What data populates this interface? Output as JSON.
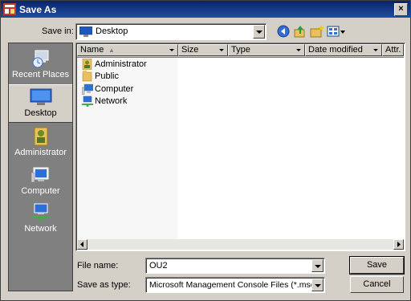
{
  "window": {
    "title": "Save As",
    "close_glyph": "×"
  },
  "toolbar": {
    "save_in_label": "Save in:",
    "save_in_value": "Desktop",
    "icons": [
      "back-icon",
      "up-folder-icon",
      "new-folder-icon",
      "view-menu-icon"
    ]
  },
  "places": [
    {
      "label": "Recent Places",
      "icon": "recent-places-icon"
    },
    {
      "label": "Desktop",
      "icon": "desktop-icon",
      "selected": true
    },
    {
      "label": "Administrator",
      "icon": "user-folder-icon"
    },
    {
      "label": "Computer",
      "icon": "computer-icon"
    },
    {
      "label": "Network",
      "icon": "network-icon"
    }
  ],
  "columns": [
    "Name",
    "Size",
    "Type",
    "Date modified",
    "Attr."
  ],
  "files": [
    {
      "name": "Administrator",
      "icon": "user-folder-icon"
    },
    {
      "name": "Public",
      "icon": "folder-icon"
    },
    {
      "name": "Computer",
      "icon": "computer-icon"
    },
    {
      "name": "Network",
      "icon": "network-icon"
    }
  ],
  "form": {
    "file_name_label": "File name:",
    "file_name_value": "OU2",
    "save_type_label": "Save as type:",
    "save_type_value": "Microsoft Management Console Files (*.msc)"
  },
  "buttons": {
    "save": "Save",
    "cancel": "Cancel"
  }
}
